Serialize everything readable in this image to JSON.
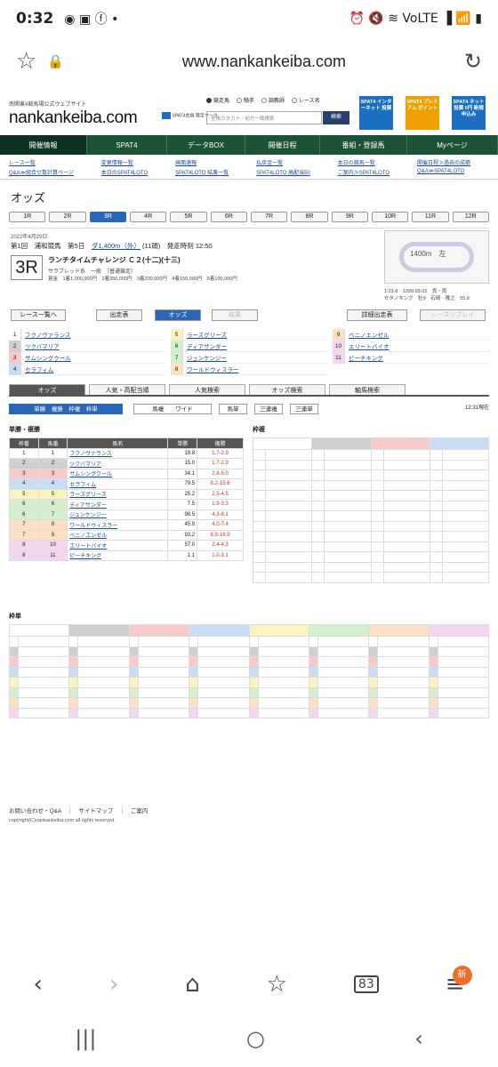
{
  "status_bar": {
    "time": "0:32",
    "notif_icons": "◉ ▣ ⓕ •",
    "right_icons": "⏰ 🔇 ≋ VoLTE ▐ 📶 ▮"
  },
  "browser": {
    "url": "www.nankankeiba.com"
  },
  "header": {
    "tagline": "南関東4競馬場公式ウェブサイト",
    "logo": "nankankeiba.com",
    "spat4_mark": "SPAT4会員\n限定マーク",
    "radios": [
      "競走馬",
      "騎手",
      "調教師",
      "レース名"
    ],
    "search_placeholder": "全角カタカナ／前方一致検索",
    "search_button": "検索",
    "ads": [
      {
        "t": "SPAT4 インターネット 投票",
        "c": "#1a6fc2"
      },
      {
        "t": "SPAT4 プレミアム ポイント",
        "c": "#f0a000"
      },
      {
        "t": "SPAT4 ネット投票 0円 新規申込み",
        "c": "#1a6fc2"
      }
    ]
  },
  "nav": [
    "開催情報",
    "SPAT4",
    "データBOX",
    "開催日程",
    "番組・登録馬",
    "Myページ"
  ],
  "subnav": [
    "レース一覧",
    "変更情報一覧",
    "画面速報",
    "払戻金一覧",
    "本日の競馬一覧",
    "開催日程≫過去の成績",
    "Q&A≫組合せ数計算ページ",
    "本日のSPAT4LOTO",
    "SPAT4LOTO 結果一覧",
    "SPAT4LOTO 高配当50",
    "ご案内≫SPAT4LOTO",
    "Q&A≫SPAT4LOTO"
  ],
  "title": "オッズ",
  "race_tabs": [
    "1R",
    "2R",
    "3R",
    "4R",
    "5R",
    "6R",
    "7R",
    "8R",
    "9R",
    "10R",
    "11R",
    "12R"
  ],
  "race": {
    "date": "2022年4月29日",
    "meet": "第1回　浦和競馬　第5日",
    "dist": "ダ1,400m（外）",
    "weather": "(11頭)　発走時刻 12:50",
    "num": "3R",
    "name": "ランチタイムチャレンジ Ｃ２(十二)(十三)",
    "cls": "サラブレッド系　一般　（普通競走）",
    "prize": "賞金　1着1,000,000円　2着350,000円　3着200,000円　4着150,000円　5着100,000円",
    "course": "1400m　左",
    "record": "1:23.8　1999.09.02　良・雨\nセタノキング　牡9　石崎　隆之　55.0"
  },
  "buttons": [
    "レース一覧へ",
    "出走表",
    "オッズ",
    "結果",
    "詳細出走表",
    "レースリプレイ"
  ],
  "entries": [
    [
      "1",
      "フクノヴァランス"
    ],
    [
      "2",
      "ツクバマリア"
    ],
    [
      "3",
      "サムシングクール"
    ],
    [
      "4",
      "セラフィム"
    ],
    [
      "5",
      "ラーズグリーズ"
    ],
    [
      "6",
      "ディアサンダー"
    ],
    [
      "7",
      "ジュンケンジー"
    ],
    [
      "8",
      "ワールドウィスラー"
    ],
    [
      "9",
      "ベニノエンゼル"
    ],
    [
      "10",
      "エリートバイオ"
    ],
    [
      "11",
      "ピーチキング"
    ]
  ],
  "tabs2": [
    "オッズ",
    "人気・高配当順",
    "人気検索",
    "オッズ検索",
    "軸馬検索"
  ],
  "bet_types": [
    "単勝　複勝　枠複　枠単",
    "馬複　　ワイド",
    "馬単",
    "三連複",
    "三連単"
  ],
  "update": "12:31現在",
  "win_title": "単勝・複勝",
  "win_headers": [
    "枠番",
    "馬番",
    "馬名",
    "単勝",
    "複勝"
  ],
  "win_rows": [
    [
      "1",
      "1",
      "フクノヴァランス",
      "19.8",
      "1.7-2.9"
    ],
    [
      "2",
      "2",
      "ツクバマリア",
      "15.0",
      "1.7-2.9"
    ],
    [
      "3",
      "3",
      "サムシングクール",
      "34.1",
      "2.8-5.0"
    ],
    [
      "4",
      "4",
      "セラフィム",
      "79.5",
      "8.2-15.6"
    ],
    [
      "5",
      "5",
      "ラーズグリーズ",
      "25.2",
      "2.5-4.5"
    ],
    [
      "6",
      "6",
      "ディアサンダー",
      "7.5",
      "1.9-3.3"
    ],
    [
      "6",
      "7",
      "ジュンケンジー",
      "98.5",
      "4.3-8.1"
    ],
    [
      "7",
      "8",
      "ワールドウィスラー",
      "45.9",
      "4.0-7.4"
    ],
    [
      "7",
      "9",
      "ベニノエンゼル",
      "93.2",
      "8.9-16.9"
    ],
    [
      "8",
      "10",
      "エリートバイオ",
      "57.0",
      "2.4-4.3"
    ],
    [
      "8",
      "11",
      "ピーチキング",
      "1.1",
      "1.0-1.1"
    ]
  ],
  "wakufuku_title": "枠複",
  "wakutan_title": "枠単",
  "footer": {
    "links": "お問い合わせ・Q&A　｜　サイトマップ　｜　ご案内",
    "copy": "copyright(C)nankankeiba.com all rights reserved."
  },
  "navbar": {
    "tabs": "83",
    "badge": "新"
  },
  "colors": {
    "nav": "#1c5236",
    "accent": "#2b67b8"
  }
}
